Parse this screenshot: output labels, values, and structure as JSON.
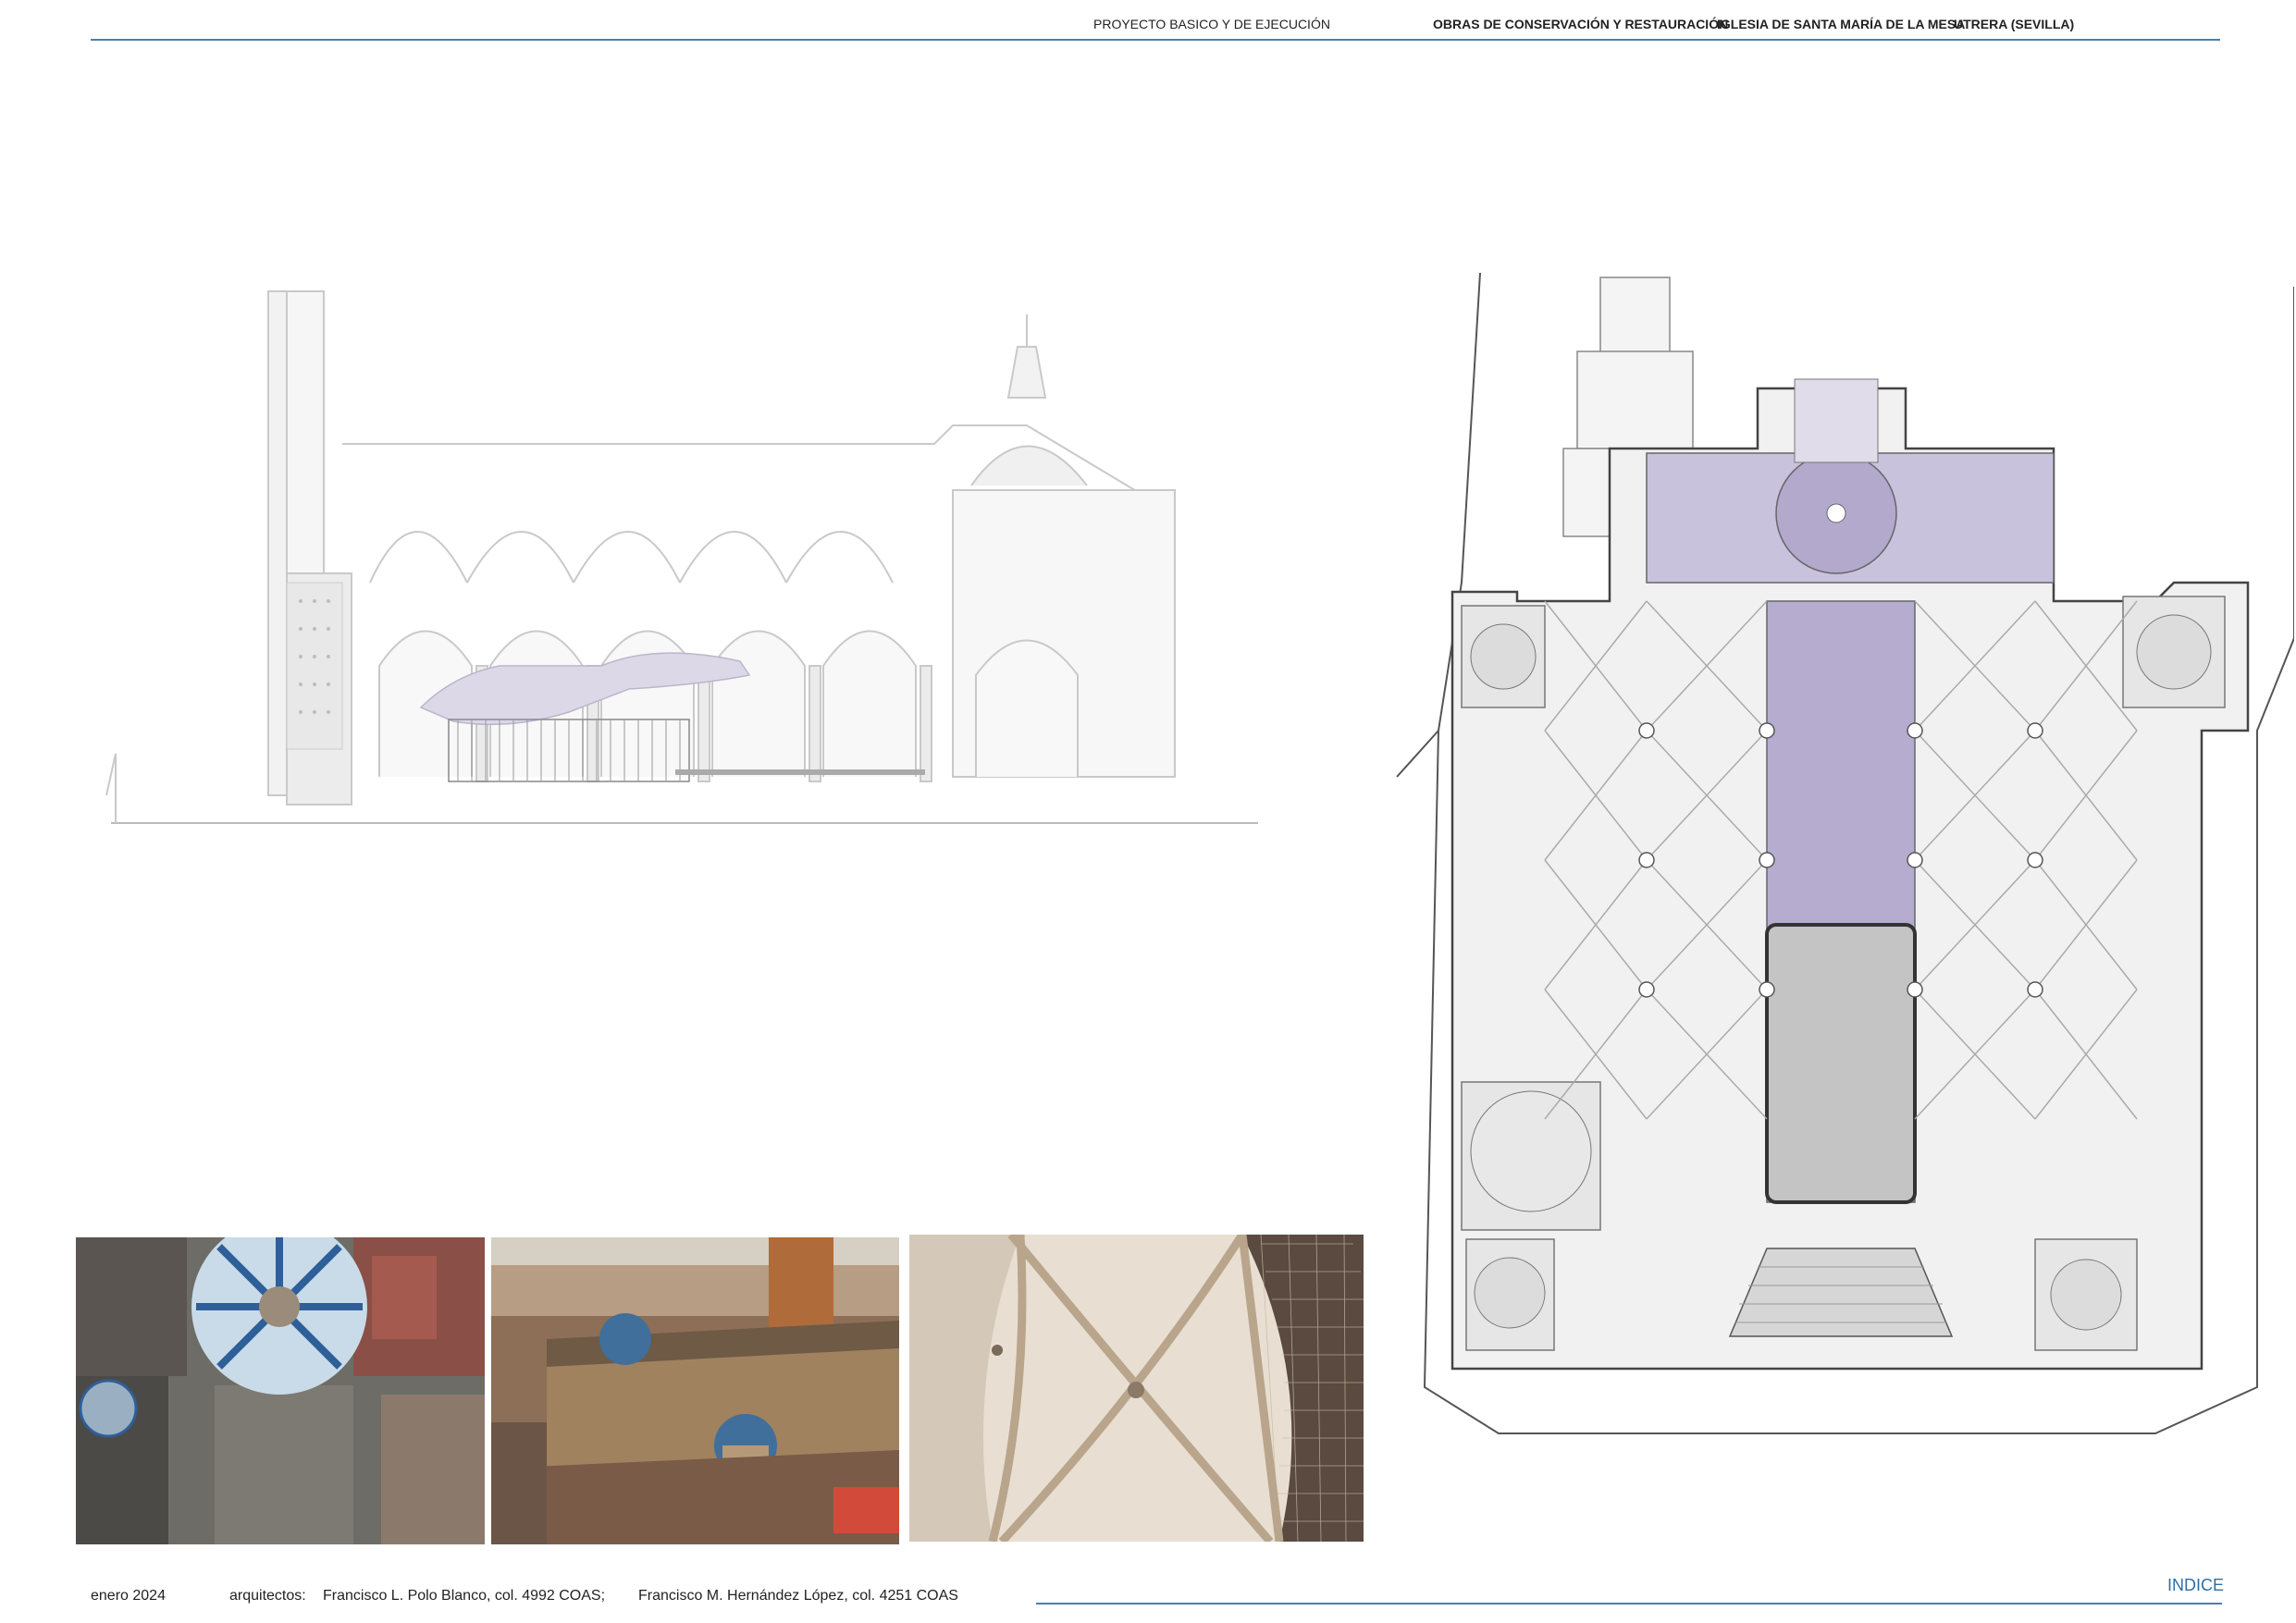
{
  "header": {
    "project_type": "PROYECTO BASICO Y DE EJECUCIÓN",
    "works": "OBRAS DE CONSERVACIÓN Y RESTAURACIÓN",
    "church": "IGLESIA DE SANTA MARÍA DE LA MESA",
    "location": "UTRERA (SEVILLA)"
  },
  "footer": {
    "date": "enero 2024",
    "architects_label": "arquitectos:",
    "architect_1": "Francisco L. Polo Blanco, col. 4992 COAS;",
    "architect_2": "Francisco M. Hernández López, col. 4251 COAS",
    "index_link": "INDICE"
  },
  "colors": {
    "accent_blue": "#2f6fa6",
    "rule_blue": "#4d7fa8",
    "nave_purple": "#8e82ad"
  }
}
